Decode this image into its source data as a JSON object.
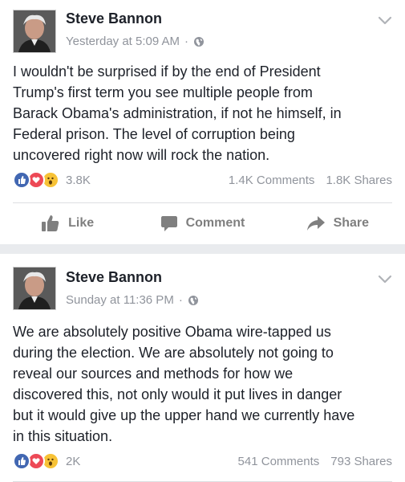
{
  "posts": [
    {
      "author": "Steve Bannon",
      "timestamp": "Yesterday at 5:09 AM",
      "audience_icon": "globe-icon",
      "text": "I wouldn't be surprised if by the end of President\nTrump's first term you see multiple people from\nBarack Obama's administration, if not he himself, in\nFederal prison. The level of corruption being\nuncovered right now will rock the nation.",
      "reaction_count": "3.8K",
      "comments": "1.4K Comments",
      "shares": "1.8K Shares",
      "actions": {
        "like": "Like",
        "comment": "Comment",
        "share": "Share"
      }
    },
    {
      "author": "Steve Bannon",
      "timestamp": "Sunday at 11:36 PM",
      "audience_icon": "globe-icon",
      "text": "We are absolutely positive Obama wire-tapped us\nduring the election. We are absolutely not going to\nreveal our sources and methods for how we\ndiscovered this, not only would it put lives in danger\nbut it would give up the upper hand we currently have\nin this situation.",
      "reaction_count": "2K",
      "comments": "541 Comments",
      "shares": "793 Shares"
    }
  ],
  "meta_separator": "·",
  "colors": {
    "like": "#4267b2",
    "love": "#ed4956",
    "wow": "#f7c236",
    "separator": "#e9ebee"
  }
}
